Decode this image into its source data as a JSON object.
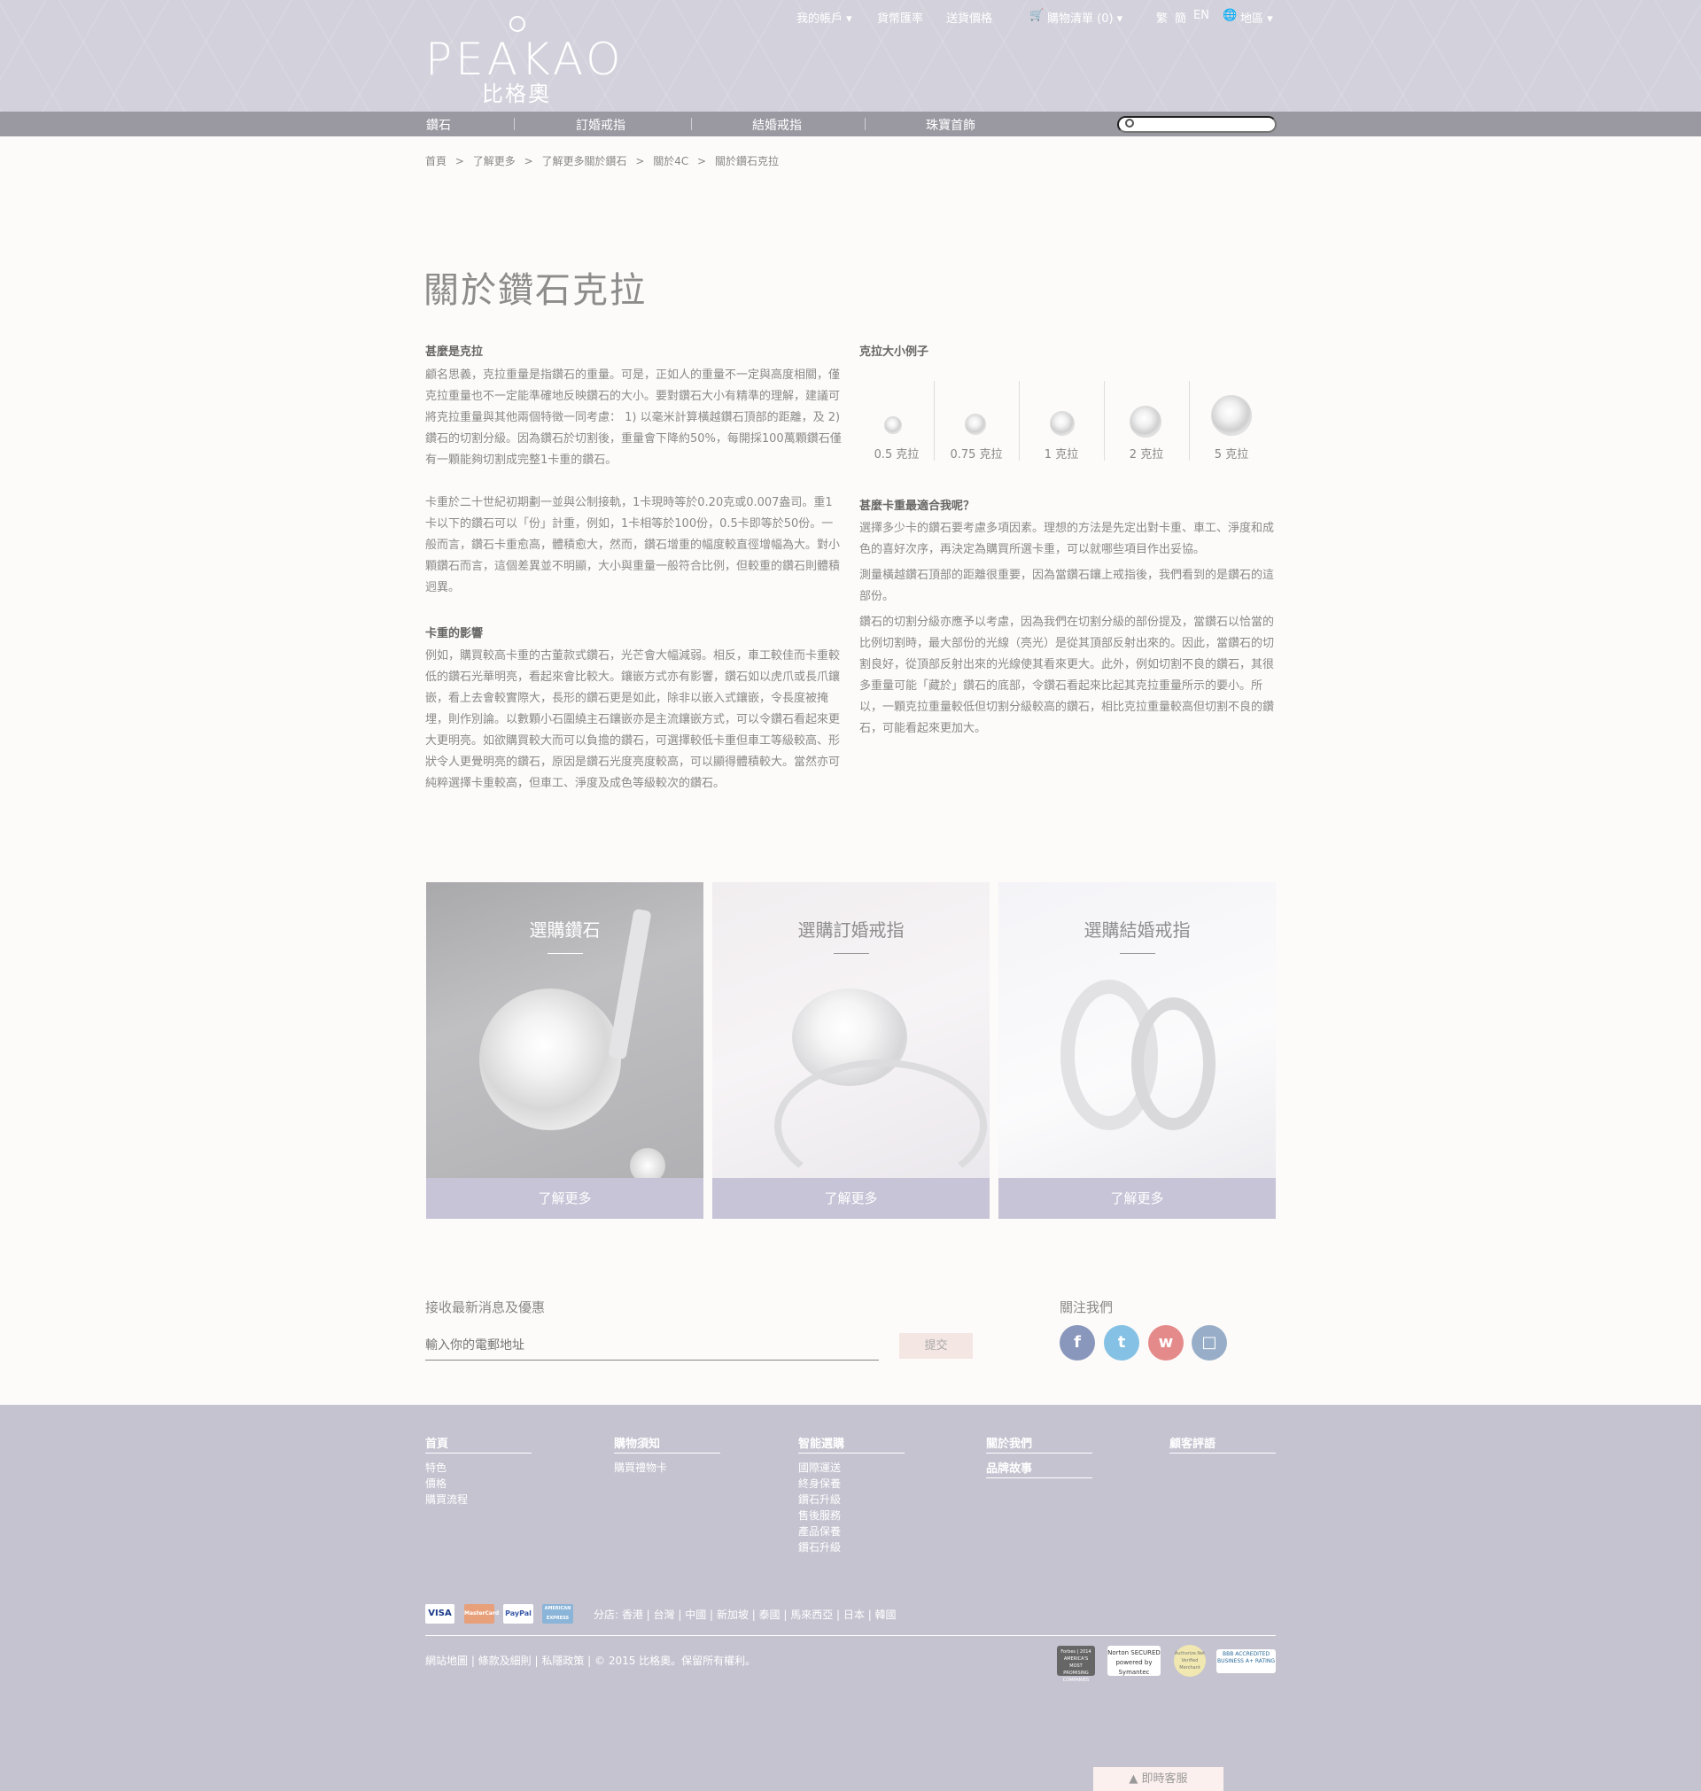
{
  "header": {
    "logo_text": "PEAKAO",
    "logo_sub": "比格奧",
    "top_links": [
      "我的帳戶 ▾",
      "貨幣匯率",
      "送貨價格",
      "購物清單 (0) ▾",
      "繁",
      "簡",
      "EN",
      "地區 ▾"
    ]
  },
  "nav": {
    "items": [
      "鑽石",
      "訂婚戒指",
      "結婚戒指",
      "珠寶首飾"
    ],
    "search_placeholder": ""
  },
  "breadcrumb": [
    "首頁",
    ">",
    "了解更多",
    ">",
    "了解更多關於鑽石",
    ">",
    "關於4C",
    ">",
    "關於鑽石克拉"
  ],
  "page_title": "關於鑽石克拉",
  "left": {
    "h1": "甚麼是克拉",
    "p1": "顧名思義，克拉重量是指鑽石的重量。可是，正如人的重量不一定與高度相關，僅克拉重量也不一定能準確地反映鑽石的大小。要對鑽石大小有精準的理解，建議可將克拉重量與其他兩個特徵一同考慮： 1) 以毫米計算橫越鑽石頂部的距離，及 2) 鑽石的切割分級。因為鑽石於切割後，重量會下降約50%，每開採100萬顆鑽石僅有一顆能夠切割成完整1卡重的鑽石。",
    "p2": "卡重於二十世紀初期劃一並與公制接軌，1卡現時等於0.20克或0.007盎司。重1卡以下的鑽石可以「份」計重，例如，1卡相等於100份，0.5卡即等於50份。一般而言，鑽石卡重愈高，體積愈大，然而，鑽石增重的幅度較直徑增幅為大。對小顆鑽石而言，這個差異並不明顯，大小與重量一般符合比例，但較重的鑽石則體積迥異。",
    "h2": "卡重的影響",
    "p3": "例如，購買較高卡重的古董款式鑽石，光芒會大幅減弱。相反，車工較佳而卡重較低的鑽石光華明亮，看起來會比較大。鑲嵌方式亦有影響，鑽石如以虎爪或長爪鑲嵌，看上去會較實際大，長形的鑽石更是如此，除非以嵌入式鑲嵌，令長度被掩埋，則作別論。以數顆小石圍繞主石鑲嵌亦是主流鑲嵌方式，可以令鑽石看起來更大更明亮。如欲購買較大而可以負擔的鑽石，可選擇較低卡重但車工等級較高、形狀令人更覺明亮的鑽石，原因是鑽石光度亮度較高，可以顯得體積較大。當然亦可純粹選擇卡重較高，但車工、淨度及成色等級較次的鑽石。"
  },
  "right": {
    "h1": "克拉大小例子",
    "carats": [
      {
        "label": "0.5 克拉",
        "size": 0.5
      },
      {
        "label": "0.75 克拉",
        "size": 0.75
      },
      {
        "label": "1 克拉",
        "size": 1
      },
      {
        "label": "2 克拉",
        "size": 2
      },
      {
        "label": "5 克拉",
        "size": 5
      }
    ],
    "h2": "甚麼卡重最適合我呢？",
    "p1": "選擇多少卡的鑽石要考慮多項因素。理想的方法是先定出對卡重、車工、淨度和成色的喜好次序，再決定為購買所選卡重，可以就哪些項目作出妥協。",
    "p2": "測量橫越鑽石頂部的距離很重要，因為當鑽石鑲上戒指後，我們看到的是鑽石的這部份。",
    "p3": "鑽石的切割分級亦應予以考慮，因為我們在切割分級的部份提及，當鑽石以恰當的比例切割時，最大部份的光線（亮光）是從其頂部反射出來的。因此，當鑽石的切割良好，從頂部反射出來的光線使其看來更大。此外，例如切割不良的鑽石，其很多重量可能「藏於」鑽石的底部，令鑽石看起來比起其克拉重量所示的要小。所以，一顆克拉重量較低但切割分級較高的鑽石，相比克拉重量較高但切割不良的鑽石，可能看起來更加大。"
  },
  "cards": [
    {
      "title": "選購鑽石",
      "button": "了解更多"
    },
    {
      "title": "選購訂婚戒指",
      "button": "了解更多"
    },
    {
      "title": "選購結婚戒指",
      "button": "了解更多"
    }
  ],
  "newsletter": {
    "title": "接收最新消息及優惠",
    "placeholder": "輸入你的電郵地址",
    "submit": "提交"
  },
  "follow": {
    "title": "關注我們",
    "icons": [
      "facebook-icon",
      "twitter-icon",
      "weibo-icon",
      "instagram-icon"
    ],
    "colors": [
      "#8a97bc",
      "#84c1e4",
      "#e58a8a",
      "#98aec8"
    ]
  },
  "footer": {
    "cols": [
      {
        "title": "首頁",
        "items": [
          "特色",
          "價格",
          "購買流程"
        ]
      },
      {
        "title": "購物須知",
        "items": [
          "購買禮物卡"
        ]
      },
      {
        "title": "智能選購",
        "items": [
          "國際運送",
          "終身保養",
          "鑽石升級",
          "售後服務",
          "產品保養",
          "鑽石升級"
        ]
      },
      {
        "title": "關於我們",
        "items": []
      },
      {
        "title": "顧客評語",
        "items": []
      }
    ],
    "extra_title": "品牌故事",
    "payments": [
      "VISA",
      "MasterCard",
      "PayPal",
      "AMERICAN EXPRESS"
    ],
    "branches": "分店: 香港 | 台灣 | 中國 | 新加坡 | 泰國 | 馬來西亞 | 日本 | 韓國",
    "copyright": "網站地圖 | 條款及細則 | 私隱政策 | © 2015 比格奧。保留所有權利。",
    "badges": [
      "Forbes | 2014 AMERICA'S MOST PROMISING COMPANIES",
      "Norton SECURED powered by Symantec",
      "Authorize.Net Verified Merchant",
      "BBB ACCREDITED BUSINESS A+ RATING"
    ]
  },
  "chat": "▲  即時客服"
}
